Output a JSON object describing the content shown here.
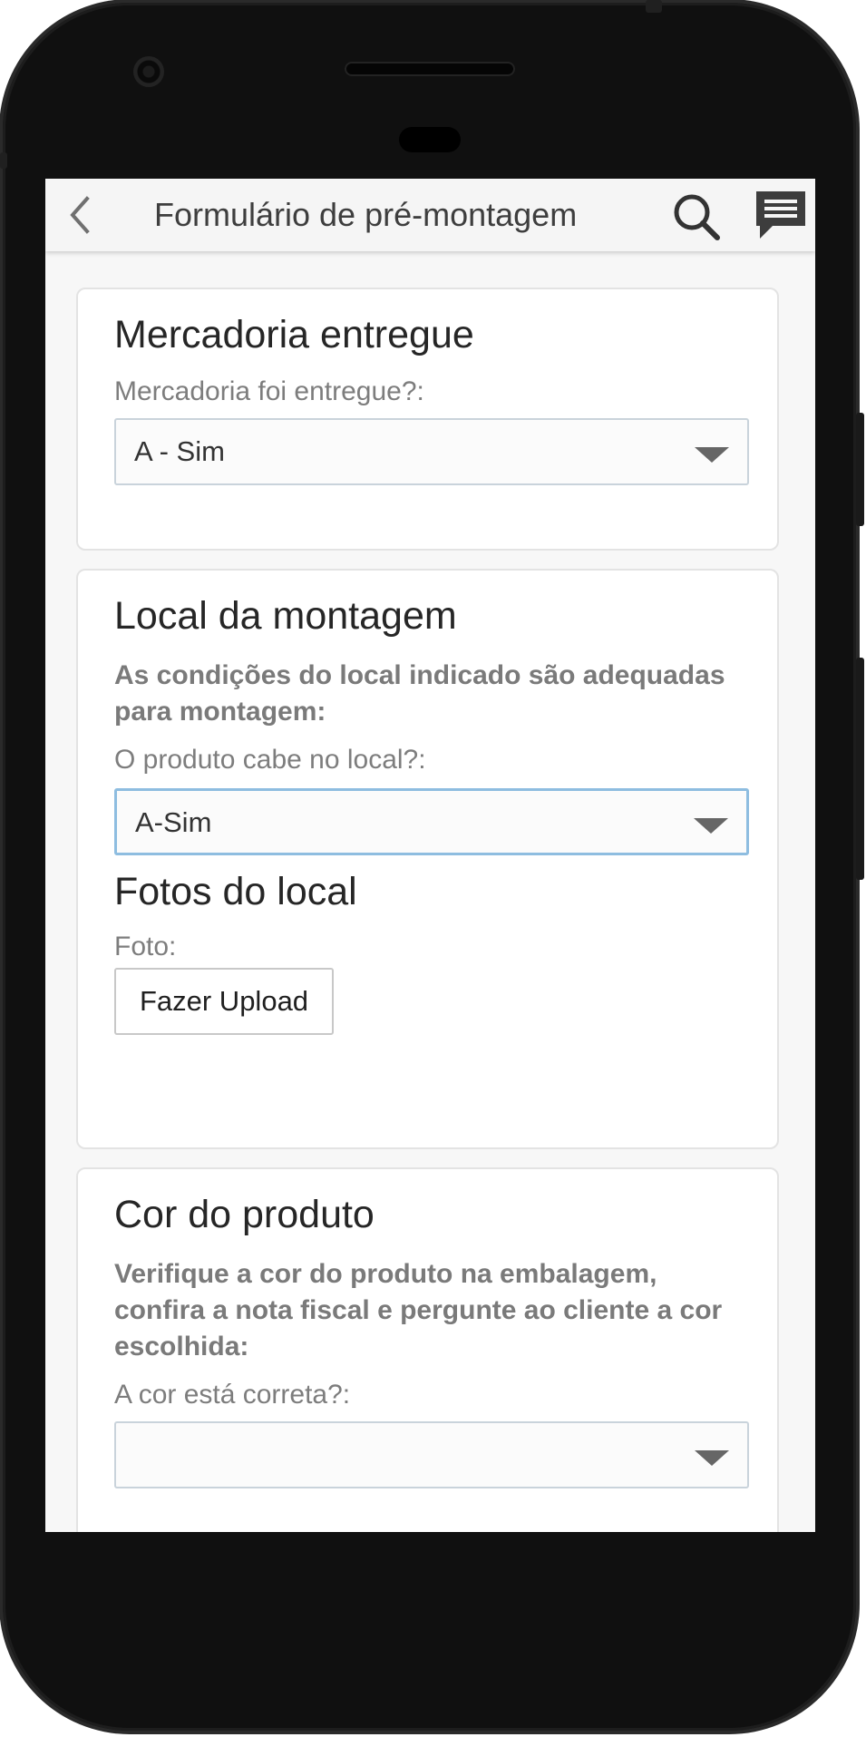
{
  "app": {
    "title": "Formulário de pré-montagem"
  },
  "toolbar": {
    "back_icon": "chevron-left-icon",
    "search_icon": "search-icon",
    "chat_icon": "chat-bubble-icon"
  },
  "sections": {
    "mercadoria": {
      "title": "Mercadoria entregue",
      "field_label": "Mercadoria foi entregue?:",
      "field_value": "A - Sim"
    },
    "local": {
      "title": "Local da montagem",
      "instruction": "As condições do local indicado são adequadas para montagem:",
      "field_label": "O produto cabe no local?:",
      "field_value": "A-Sim",
      "photos_title": "Fotos do local",
      "photo_label": "Foto:",
      "upload_label": "Fazer Upload"
    },
    "cor": {
      "title": "Cor do produto",
      "instruction": "Verifique a cor do produto na embalagem, confira a nota fiscal e pergunte ao cliente a cor escolhida:",
      "field_label": "A cor está correta?:",
      "field_value": ""
    }
  },
  "colors": {
    "focus_border": "#8ebde0",
    "card_border": "#e3e3e3",
    "label_gray": "#7d7d7d"
  }
}
